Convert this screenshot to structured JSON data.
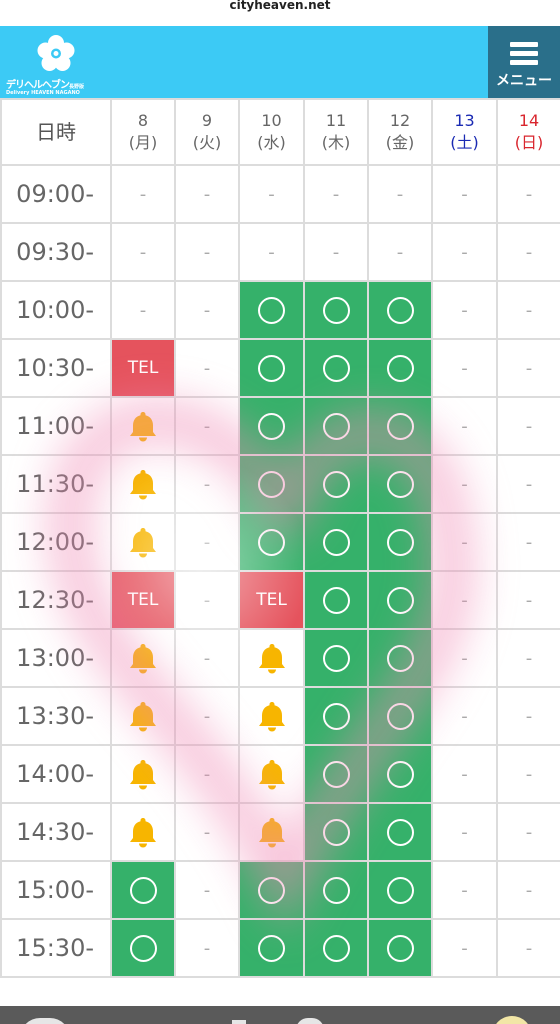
{
  "browser": {
    "url": "cityheaven.net"
  },
  "header": {
    "brand": "デリヘルヘブン",
    "brand_sub": "長野版",
    "brand_tagline": "Delivery HEAVEN NAGANO",
    "menu_label": "メニュー",
    "colors": {
      "bar": "#3ccaf5",
      "menu": "#2a6f8a"
    }
  },
  "schedule": {
    "corner_label": "日時",
    "days": [
      {
        "num": "8",
        "dow": "(月)",
        "kind": "weekday"
      },
      {
        "num": "9",
        "dow": "(火)",
        "kind": "weekday"
      },
      {
        "num": "10",
        "dow": "(水)",
        "kind": "weekday"
      },
      {
        "num": "11",
        "dow": "(木)",
        "kind": "weekday"
      },
      {
        "num": "12",
        "dow": "(金)",
        "kind": "weekday"
      },
      {
        "num": "13",
        "dow": "(土)",
        "kind": "sat"
      },
      {
        "num": "14",
        "dow": "(日)",
        "kind": "sun"
      }
    ],
    "rows": [
      {
        "time": "09:00-",
        "cells": [
          "-",
          "-",
          "-",
          "-",
          "-",
          "-",
          "-"
        ]
      },
      {
        "time": "09:30-",
        "cells": [
          "-",
          "-",
          "-",
          "-",
          "-",
          "-",
          "-"
        ]
      },
      {
        "time": "10:00-",
        "cells": [
          "-",
          "-",
          "○",
          "○",
          "○",
          "-",
          "-"
        ]
      },
      {
        "time": "10:30-",
        "cells": [
          "TEL",
          "-",
          "○",
          "○",
          "○",
          "-",
          "-"
        ]
      },
      {
        "time": "11:00-",
        "cells": [
          "bell",
          "-",
          "○",
          "○",
          "○",
          "-",
          "-"
        ]
      },
      {
        "time": "11:30-",
        "cells": [
          "bell",
          "-",
          "○",
          "○",
          "○",
          "-",
          "-"
        ]
      },
      {
        "time": "12:00-",
        "cells": [
          "bell",
          "-",
          "○",
          "○",
          "○",
          "-",
          "-"
        ]
      },
      {
        "time": "12:30-",
        "cells": [
          "TEL",
          "-",
          "TEL",
          "○",
          "○",
          "-",
          "-"
        ]
      },
      {
        "time": "13:00-",
        "cells": [
          "bell",
          "-",
          "bell",
          "○",
          "○",
          "-",
          "-"
        ]
      },
      {
        "time": "13:30-",
        "cells": [
          "bell",
          "-",
          "bell",
          "○",
          "○",
          "-",
          "-"
        ]
      },
      {
        "time": "14:00-",
        "cells": [
          "bell",
          "-",
          "bell",
          "○",
          "○",
          "-",
          "-"
        ]
      },
      {
        "time": "14:30-",
        "cells": [
          "bell",
          "-",
          "bell",
          "○",
          "○",
          "-",
          "-"
        ]
      },
      {
        "time": "15:00-",
        "cells": [
          "○",
          "-",
          "○",
          "○",
          "○",
          "-",
          "-"
        ]
      },
      {
        "time": "15:30-",
        "cells": [
          "○",
          "-",
          "○",
          "○",
          "○",
          "-",
          "-"
        ]
      }
    ],
    "colors": {
      "available": "#35b16a",
      "tel": "#e5535d",
      "bell": "#f7b500",
      "grid": "#dcdcdc",
      "sat": "#1a2ab3",
      "sun": "#d9262e"
    }
  }
}
